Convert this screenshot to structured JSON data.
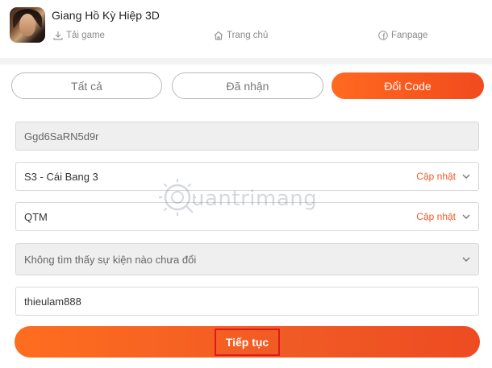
{
  "header": {
    "app_title": "Giang Hồ Kỳ Hiệp 3D",
    "links": {
      "download": "Tải game",
      "home": "Trang chủ",
      "fanpage": "Fanpage"
    }
  },
  "tabs": {
    "all": "Tất cả",
    "received": "Đã nhận",
    "redeem": "Đổi Code",
    "active": "redeem"
  },
  "form": {
    "code": "Ggd6SaRN5d9r",
    "server": "S3 - Cái Bang 3",
    "character": "QTM",
    "event": "Không tìm thấy sự kiện nào chưa đổi",
    "account": "thieulam888",
    "update_label": "Cập nhật"
  },
  "watermark": "uantrimang",
  "submit": {
    "label": "Tiếp tục"
  },
  "colors": {
    "accent": "#f15a24",
    "highlight_box": "#e0191e"
  }
}
